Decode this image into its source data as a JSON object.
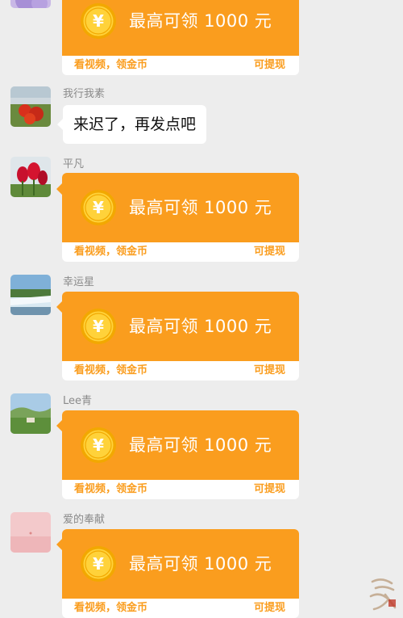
{
  "messages": [
    {
      "type": "redpacket",
      "sender": "",
      "title": "最高可领 1000 元",
      "footer_left": "看视频，领金币",
      "footer_right": "可提现"
    },
    {
      "type": "text",
      "sender": "我行我素",
      "text": "来迟了，再发点吧"
    },
    {
      "type": "redpacket",
      "sender": "平凡",
      "title": "最高可领 1000 元",
      "footer_left": "看视频，领金币",
      "footer_right": "可提现"
    },
    {
      "type": "redpacket",
      "sender": "幸运星",
      "title": "最高可领 1000 元",
      "footer_left": "看视频，领金币",
      "footer_right": "可提现"
    },
    {
      "type": "redpacket",
      "sender": "Lee青",
      "title": "最高可领 1000 元",
      "footer_left": "看视频，领金币",
      "footer_right": "可提现"
    },
    {
      "type": "redpacket",
      "sender": "爱的奉献",
      "title": "最高可领 1000 元",
      "footer_left": "看视频，领金币",
      "footer_right": "可提现"
    }
  ],
  "colors": {
    "card_orange": "#fa9d1e",
    "background": "#ededed",
    "coin_gold": "#ffd23a"
  },
  "icons": {
    "coin": "yen-coin-icon",
    "watermark": "calligraphy-seal-watermark"
  }
}
